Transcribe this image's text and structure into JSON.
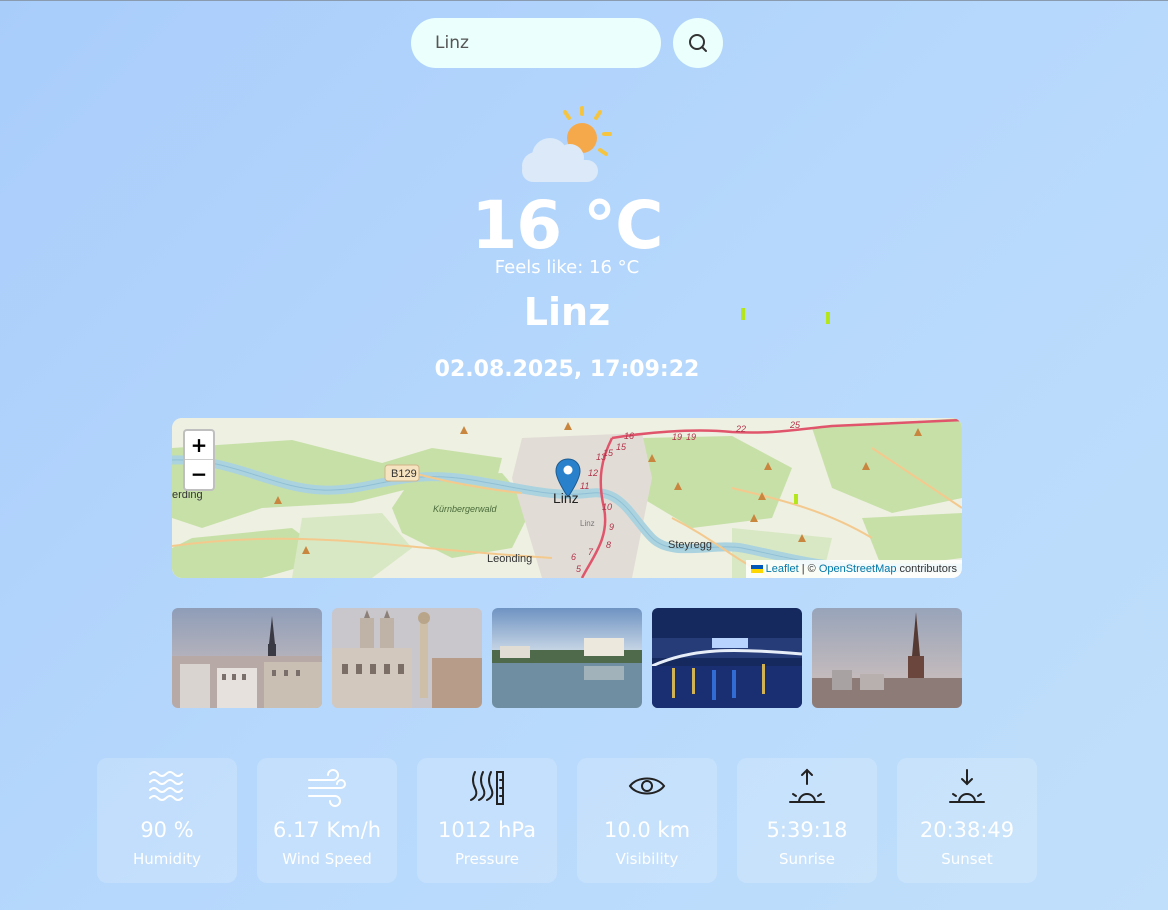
{
  "search": {
    "value": "Linz",
    "button_icon": "search-icon"
  },
  "weather": {
    "icon": "partly-cloudy-icon",
    "temperature": "16 °C",
    "feels_like": "Feels like: 16 °C",
    "city": "Linz",
    "datetime": "02.08.2025, 17:09:22"
  },
  "map": {
    "zoom_in": "+",
    "zoom_out": "−",
    "marker_label": "Linz",
    "place_labels": [
      "Kürnbergerwald",
      "Leonding",
      "Steyregg",
      "Linz",
      "B129",
      "erding"
    ],
    "route_numbers": [
      "16",
      "19",
      "19",
      "22",
      "25",
      "13",
      "15",
      "15",
      "12",
      "11",
      "10",
      "9",
      "8",
      "7",
      "6",
      "5"
    ],
    "attribution": {
      "leaflet": "Leaflet",
      "separator": " | © ",
      "osm": "OpenStreetMap",
      "suffix": " contributors"
    }
  },
  "photos": [
    {
      "name": "linz-city-skyline-cathedral"
    },
    {
      "name": "linz-hauptplatz-trinity-column"
    },
    {
      "name": "linz-danube-riverside"
    },
    {
      "name": "linz-bridge-night"
    },
    {
      "name": "linz-cathedral-dusk"
    }
  ],
  "stats": [
    {
      "icon": "humidity-icon",
      "value": "90 %",
      "label": "Humidity"
    },
    {
      "icon": "wind-icon",
      "value": "6.17 Km/h",
      "label": "Wind Speed"
    },
    {
      "icon": "pressure-icon",
      "value": "1012 hPa",
      "label": "Pressure"
    },
    {
      "icon": "eye-icon",
      "value": "10.0 km",
      "label": "Visibility"
    },
    {
      "icon": "sunrise-icon",
      "value": "5:39:18",
      "label": "Sunrise"
    },
    {
      "icon": "sunset-icon",
      "value": "20:38:49",
      "label": "Sunset"
    }
  ],
  "colors": {
    "background": "#b2d5fc",
    "search_bg": "#ebfffc",
    "accent_tick": "#b5e61d",
    "marker": "#2a81cb"
  }
}
